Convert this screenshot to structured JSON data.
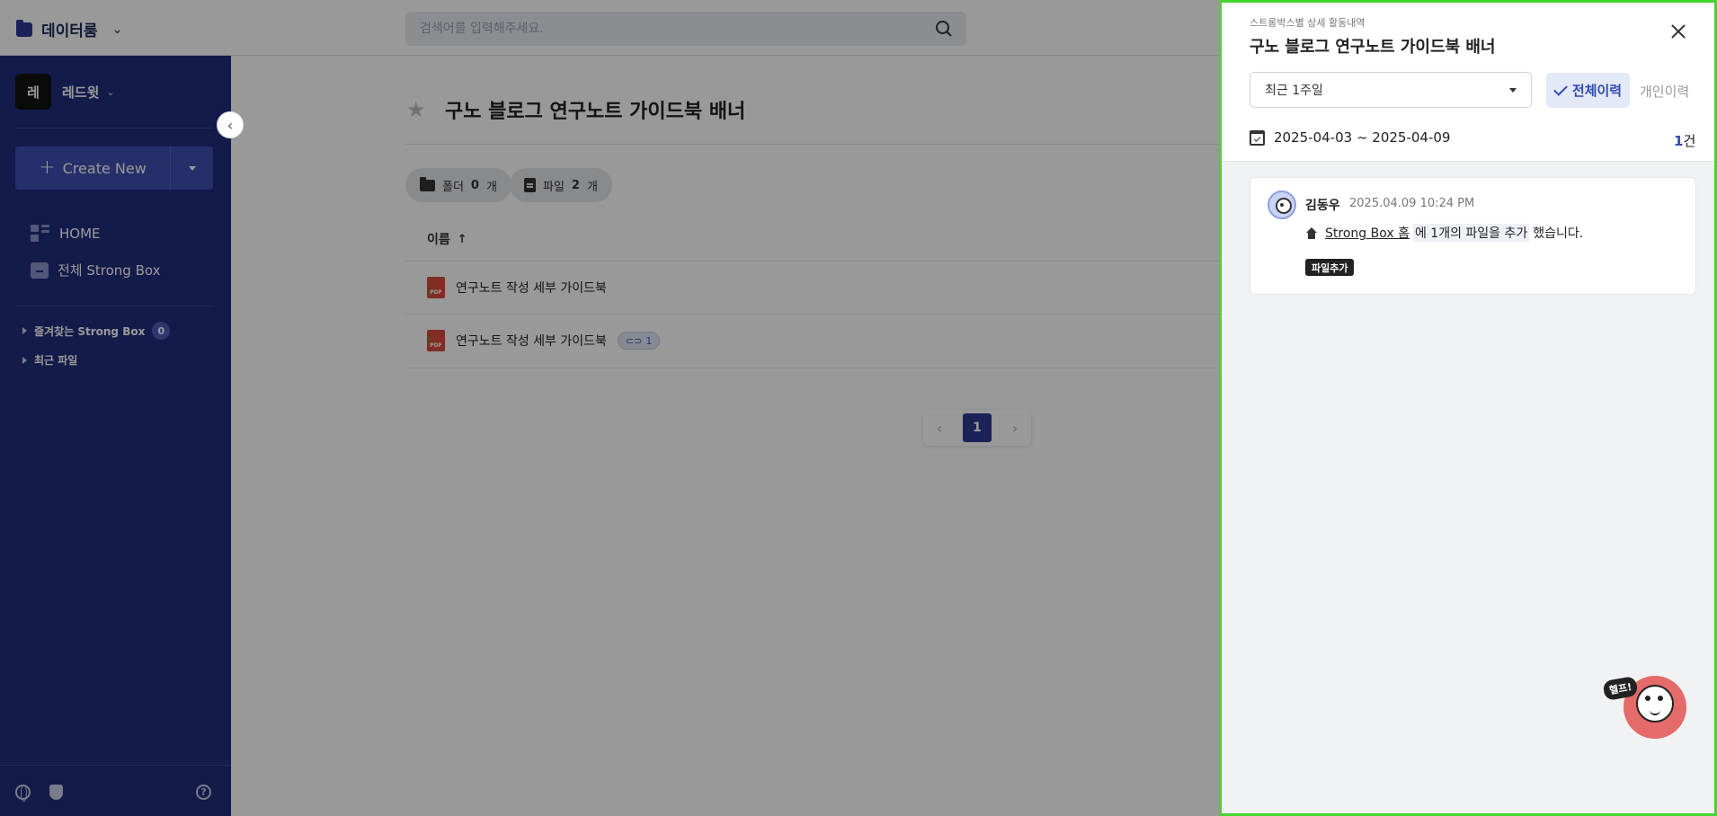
{
  "topbar": {
    "brand": "데이터룸",
    "search_placeholder": "검색어를 입력해주세요."
  },
  "sidebar": {
    "workspace_avatar": "레",
    "workspace_name": "레드윗",
    "create_label": "Create New",
    "nav": [
      {
        "label": "HOME"
      },
      {
        "label": "전체 Strong Box"
      }
    ],
    "tree": [
      {
        "label": "즐겨찾는 Strong Box",
        "count": "0"
      },
      {
        "label": "최근 파일"
      }
    ]
  },
  "main": {
    "title": "구노 블로그 연구노트 가이드북 배너",
    "folder_chip": {
      "label": "폴더",
      "count": "0",
      "unit": "개"
    },
    "file_chip": {
      "label": "파일",
      "count": "2",
      "unit": "개"
    },
    "column_name": "이름",
    "files": [
      {
        "name": "연구노트 작성 세부 가이드북",
        "icon": "PDF"
      },
      {
        "name": "연구노트 작성 세부 가이드북",
        "icon": "PDF",
        "link_count": "1"
      }
    ],
    "pagination": {
      "current": "1"
    }
  },
  "panel": {
    "subtitle": "스트롱박스별 상세 활동내역",
    "title": "구노 블로그 연구노트 가이드북 배너",
    "period": "최근 1주일",
    "tab_all": "전체이력",
    "tab_mine": "개인이력",
    "date_range": "2025-04-03 ~ 2025-04-09",
    "count": "1",
    "count_unit": "건",
    "activity": {
      "user": "김동우",
      "time": "2025.04.09 10:24 PM",
      "location": "Strong Box 홈",
      "text_mid": "에 1개의 파일을 추가",
      "text_end": "했습니다.",
      "tag": "파일추가"
    },
    "help_label": "헬프!"
  },
  "colors": {
    "sidebar": "#212d7d",
    "accent": "#2d3a92",
    "panel_border": "#44d62c"
  }
}
